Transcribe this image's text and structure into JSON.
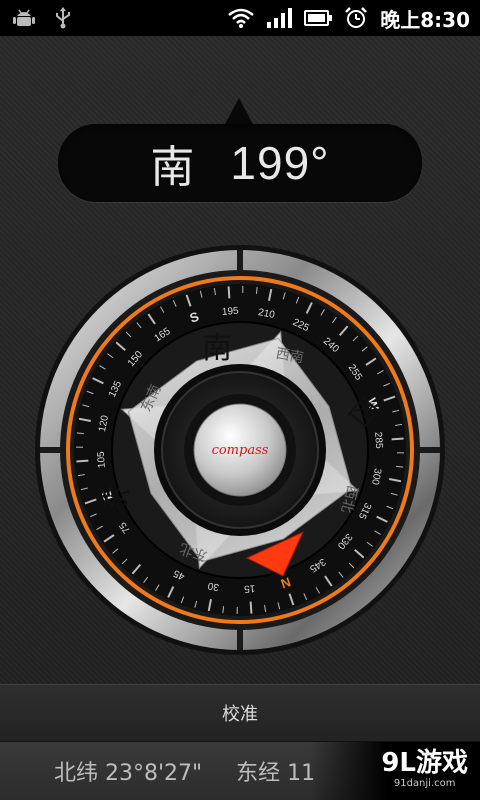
{
  "status_bar": {
    "icons": [
      "android-icon",
      "usb-icon",
      "wifi-icon",
      "signal-icon",
      "battery-icon",
      "alarm-icon"
    ],
    "time": "晚上8:30"
  },
  "heading": {
    "direction": "南",
    "degrees": "199°"
  },
  "compass": {
    "center_label": "compass",
    "cardinal_inner": {
      "south": "南",
      "west": "西",
      "east": "东"
    },
    "intercardinal_inner": {
      "southwest": "西南",
      "southeast": "东南",
      "northwest": "西北",
      "northeast": "东北"
    },
    "ring_letters": [
      "S",
      "W",
      "E",
      "N"
    ],
    "ring_numbers": [
      "195",
      "210",
      "225",
      "240",
      "255",
      "285",
      "300",
      "315",
      "330",
      "345",
      "15",
      "30",
      "45",
      "75",
      "105",
      "120",
      "135",
      "150",
      "165"
    ],
    "accent": "#f07a1a",
    "pointer_color": "#ff3a10"
  },
  "calibrate": {
    "label": "校准"
  },
  "coords": {
    "latitude": "北纬 23°8'27\"",
    "longitude": "东经 11"
  },
  "watermark": {
    "main": "9L游戏",
    "sub": "91danji.com"
  }
}
